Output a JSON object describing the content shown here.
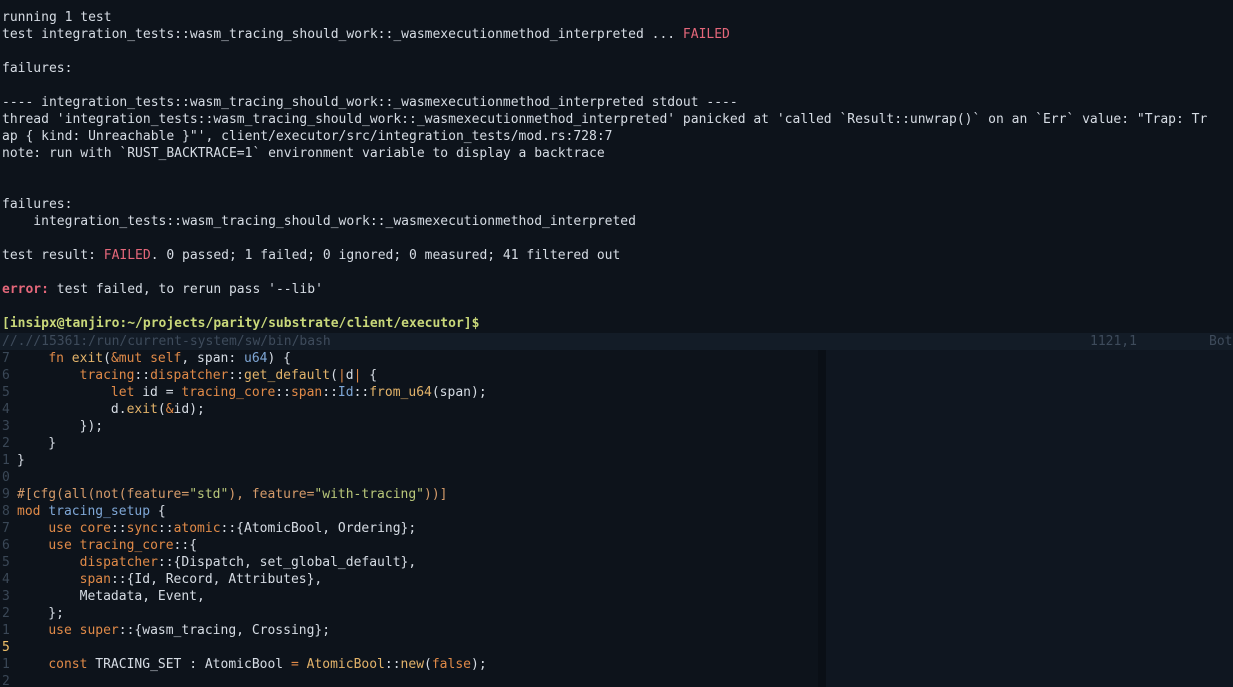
{
  "terminal": {
    "lines": [
      {
        "t": "running 1 test"
      },
      {
        "t": "test integration_tests::wasm_tracing_should_work::_wasmexecutionmethod_interpreted ... ",
        "red": "FAILED"
      },
      {
        "t": ""
      },
      {
        "t": "failures:"
      },
      {
        "t": ""
      },
      {
        "t": "---- integration_tests::wasm_tracing_should_work::_wasmexecutionmethod_interpreted stdout ----"
      },
      {
        "t": "thread 'integration_tests::wasm_tracing_should_work::_wasmexecutionmethod_interpreted' panicked at 'called `Result::unwrap()` on an `Err` value: \"Trap: Tr"
      },
      {
        "t": "ap { kind: Unreachable }\"', client/executor/src/integration_tests/mod.rs:728:7"
      },
      {
        "t": "note: run with `RUST_BACKTRACE=1` environment variable to display a backtrace"
      },
      {
        "t": ""
      },
      {
        "t": ""
      },
      {
        "t": "failures:"
      },
      {
        "t": "    integration_tests::wasm_tracing_should_work::_wasmexecutionmethod_interpreted"
      },
      {
        "t": ""
      },
      {
        "pre": "test result: ",
        "red": "FAILED",
        "t": ". 0 passed; 1 failed; 0 ignored; 0 measured; 41 filtered out"
      },
      {
        "t": ""
      },
      {
        "err": "error:",
        "t": " test failed, to rerun pass '--lib'"
      },
      {
        "t": ""
      },
      {
        "prompt": "[insipx@tanjiro:~/projects/parity/substrate/client/executor]$"
      }
    ]
  },
  "status_bar": {
    "path": "//.//15361:/run/current-system/sw/bin/bash",
    "position": "1121,1",
    "scroll": "Bot"
  },
  "editor": {
    "line_numbers": [
      "7",
      "6",
      "5",
      "4",
      "3",
      "2",
      "1",
      "0",
      "9",
      "8",
      "7",
      "6",
      "5",
      "4",
      "3",
      "2",
      "1",
      "5",
      "1",
      "2"
    ],
    "current_line_index": 17
  },
  "colors": {
    "background": "#0d131b",
    "foreground": "#d6dce4",
    "failed_red": "#e4677a",
    "prompt_green": "#c9d87a",
    "keyword_orange": "#e08a48",
    "type_blue": "#7fa7d6",
    "string_green": "#b9c77a"
  }
}
